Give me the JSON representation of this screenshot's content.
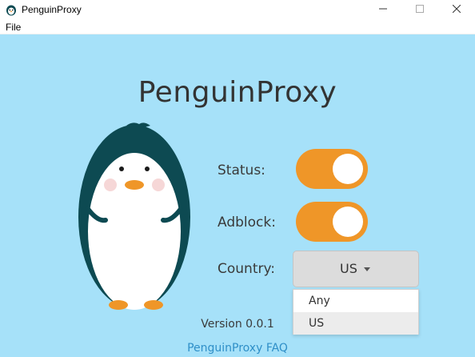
{
  "window": {
    "title": "PenguinProxy",
    "icon": "penguin-icon",
    "controls": [
      "minimize-icon",
      "maximize-icon",
      "close-icon"
    ]
  },
  "menubar": {
    "file_label": "File"
  },
  "main": {
    "title": "PenguinProxy",
    "status_label": "Status:",
    "status_on": true,
    "adblock_label": "Adblock:",
    "adblock_on": true,
    "country_label": "Country:",
    "country_value": "US",
    "country_options": [
      "Any",
      "US"
    ],
    "version": "Version 0.0.1",
    "faq_link": "PenguinProxy FAQ"
  },
  "colors": {
    "background": "#a6e1f9",
    "toggle_on": "#ef9628",
    "penguin_body": "#0d4a52",
    "penguin_belly": "#ffffff",
    "beak_feet": "#ef9628",
    "cheeks": "#f2c6c6",
    "link": "#2f8fc8"
  }
}
